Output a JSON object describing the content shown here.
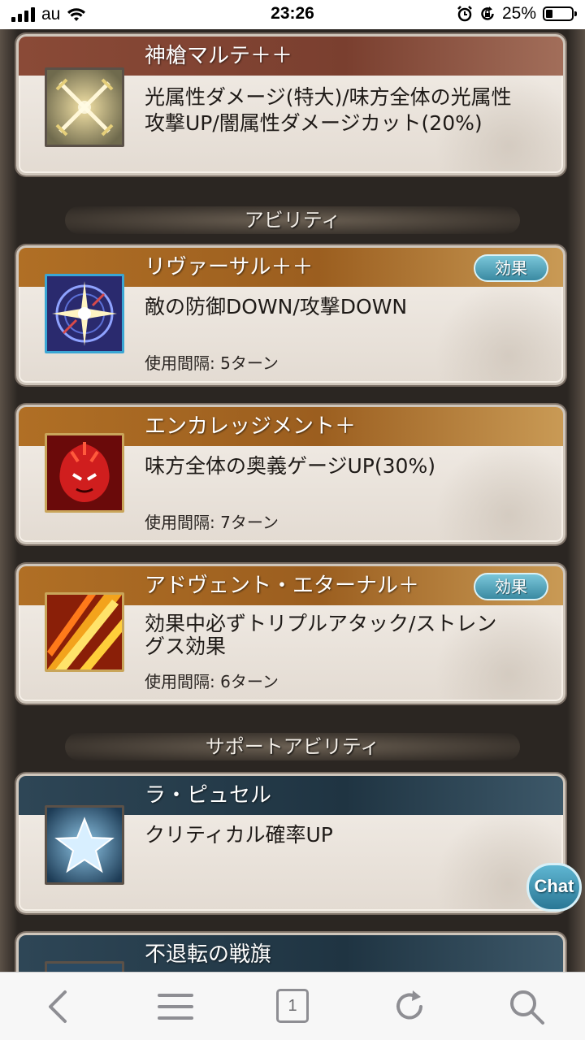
{
  "status": {
    "carrier": "au",
    "time": "23:26",
    "battery": "25%",
    "battery_fraction": 0.25
  },
  "weapon": {
    "name": "神槍マルテ＋＋",
    "desc1": "光属性ダメージ(特大)/味方全体の光属性",
    "desc2": "攻撃UP/闇属性ダメージカット(20%)"
  },
  "section_ability": "アビリティ",
  "abilities": [
    {
      "name": "リヴァーサル＋＋",
      "effect_label": "効果",
      "desc1": "敵の防御DOWN/攻撃DOWN",
      "interval": "使用間隔: 5ターン"
    },
    {
      "name": "エンカレッジメント＋",
      "desc1": "味方全体の奥義ゲージUP(30%)",
      "interval": "使用間隔: 7ターン"
    },
    {
      "name": "アドヴェント・エターナル＋",
      "effect_label": "効果",
      "desc1": "効果中必ずトリプルアタック/ストレン",
      "desc2": "グス効果",
      "interval": "使用間隔: 6ターン"
    }
  ],
  "section_support": "サポートアビリティ",
  "supports": [
    {
      "name": "ラ・ピュセル",
      "desc1": "クリティカル確率UP"
    },
    {
      "name": "不退転の戦旗"
    }
  ],
  "chat_label": "Chat",
  "browser": {
    "tab_count": "1"
  }
}
